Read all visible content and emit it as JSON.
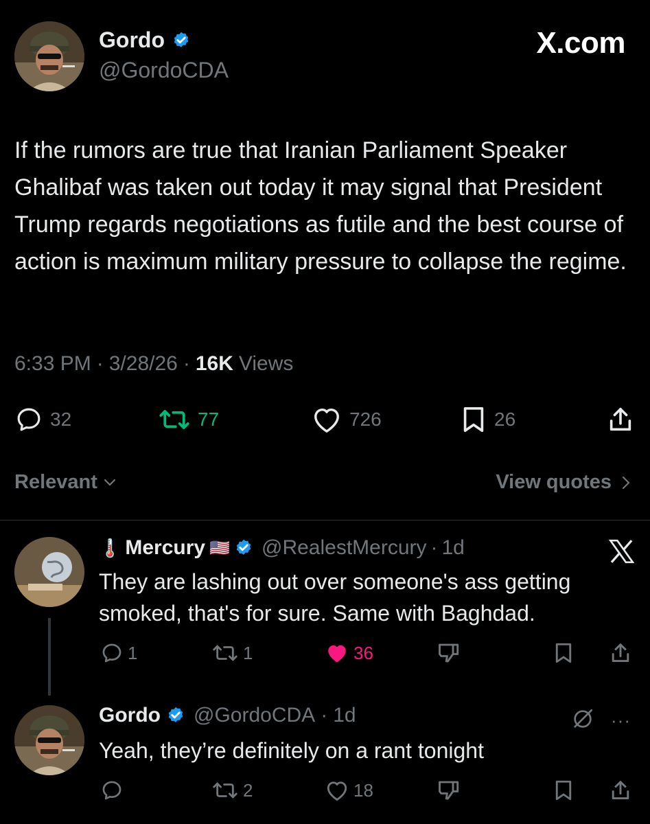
{
  "brand": {
    "site_logo": "X.com",
    "close_icon": "x-logo-icon"
  },
  "main_tweet": {
    "author_name": "Gordo",
    "author_handle": "@GordoCDA",
    "text": "If the rumors are true that Iranian Parliament Speaker Ghalibaf was taken out today it may signal that President Trump regards negotiations as futile and the best course of action is maximum military pressure to collapse the regime.",
    "time": "6:33 PM",
    "date": "3/28/26",
    "views_count": "16K",
    "views_label": "Views",
    "replies": "32",
    "reposts": "77",
    "likes": "726",
    "bookmarks": "26"
  },
  "sort": {
    "label": "Relevant",
    "view_quotes": "View quotes"
  },
  "replies": [
    {
      "prefix_emoji": "🌡️",
      "author_name": "Mercury",
      "flag": "🇺🇸",
      "handle": "@RealestMercury",
      "age": "1d",
      "text": "They are lashing out over someone's ass getting smoked, that's for sure. Same with Baghdad.",
      "replies": "1",
      "reposts": "1",
      "likes": "36"
    },
    {
      "author_name": "Gordo",
      "handle": "@GordoCDA",
      "age": "1d",
      "text": "Yeah, they’re definitely on a rant tonight",
      "replies": "",
      "reposts": "2",
      "likes": "18"
    }
  ],
  "colors": {
    "background": "#000000",
    "text": "#e7e9ea",
    "muted": "#71767b",
    "verified": "#1d9bf0",
    "repost_active": "#00ba7c",
    "like_active": "#f91880"
  }
}
